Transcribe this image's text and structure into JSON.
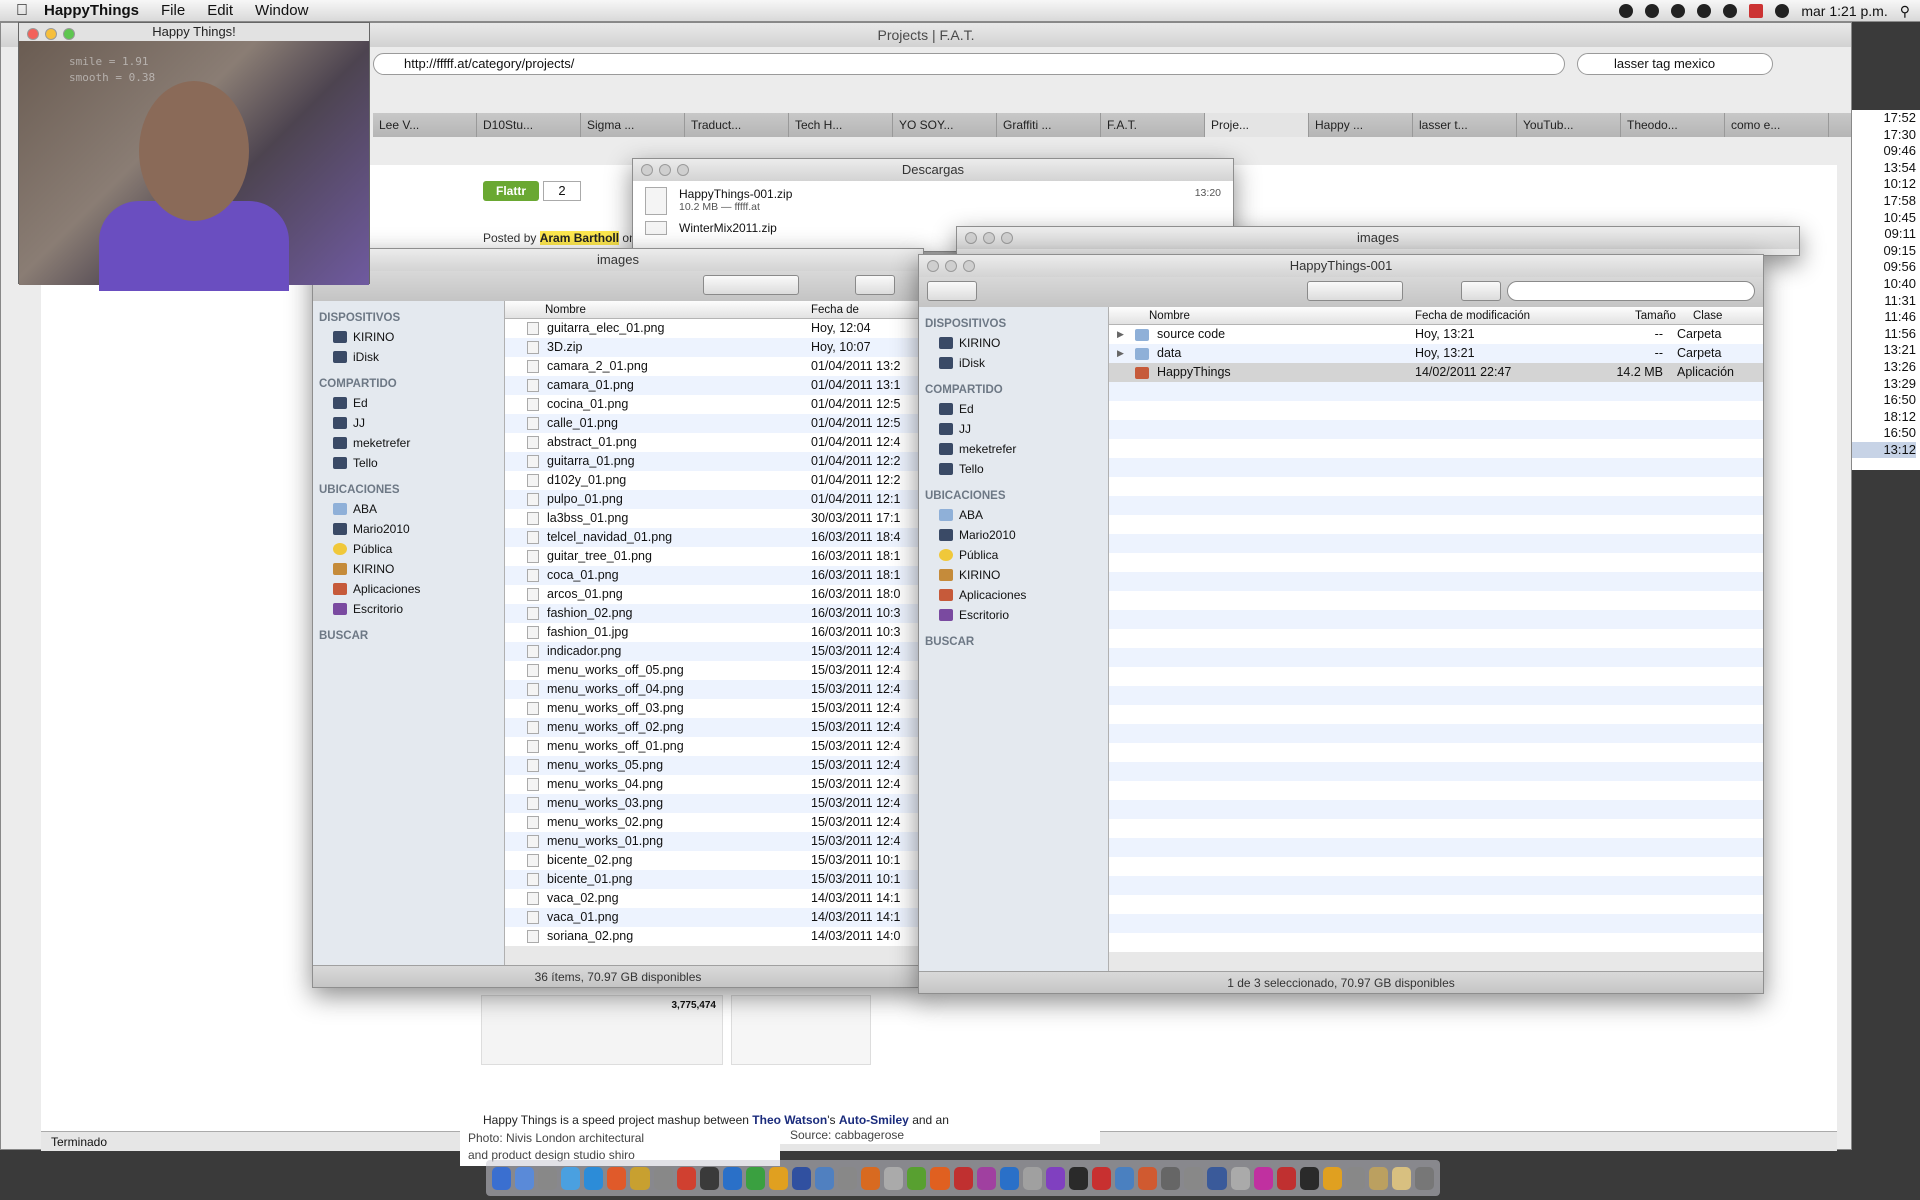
{
  "menubar": {
    "app_name": "HappyThings",
    "menus": [
      "File",
      "Edit",
      "Window"
    ],
    "clock": "mar 1:21 p.m."
  },
  "browser": {
    "title": "Projects | F.A.T.",
    "url": "http://fffff.at/category/projects/",
    "search_value": "lasser tag mexico",
    "tabs": [
      "Lee V...",
      "D10Stu...",
      "Sigma ...",
      "Traduct...",
      "Tech H...",
      "YO SOY...",
      "Graffiti ...",
      "F.A.T.",
      "Proje...",
      "Happy ...",
      "lasser t...",
      "YouTub...",
      "Theodo...",
      "como e..."
    ],
    "status": "Terminado",
    "flattr_label": "Flattr",
    "flattr_count": "2",
    "posted_prefix": "Posted by",
    "posted_author": "Aram Bartholl",
    "posted_suffix": "on",
    "body_prefix": "Happy Things is a speed project mashup between",
    "body_link1": "Theo Watson",
    "body_mid": "'s",
    "body_link2": "Auto-Smiley",
    "body_suffix": "and an",
    "photo_caption1": "Photo: Nivis London architectural",
    "photo_caption2": "and product design studio shiro",
    "source": "Source: cabbagerose",
    "views": "3,775,474"
  },
  "timestamps": [
    "17:52",
    "17:30",
    "09:46",
    "13:54",
    "10:12",
    "17:58",
    "10:45",
    "09:11",
    "09:15",
    "09:56",
    "10:40",
    "11:31",
    "11:46",
    "11:56",
    "13:21",
    "13:26",
    "13:29",
    "16:50",
    "18:12",
    "16:50",
    "13:12"
  ],
  "webcam": {
    "title": "Happy Things!",
    "overlay_smile": "smile      = 1.91",
    "overlay_smooth": "smooth = 0.38"
  },
  "downloads": {
    "title": "Descargas",
    "items": [
      {
        "name": "HappyThings-001.zip",
        "meta": "10.2 MB — fffff.at",
        "time": "13:20"
      },
      {
        "name": "WinterMix2011.zip",
        "meta": "",
        "time": ""
      }
    ]
  },
  "finder_images": {
    "title": "images",
    "back_title": "images",
    "columns": {
      "name": "Nombre",
      "date": "Fecha de modificación"
    },
    "sidebar": {
      "devices_header": "DISPOSITIVOS",
      "devices": [
        "KIRINO",
        "iDisk"
      ],
      "shared_header": "COMPARTIDO",
      "shared": [
        "Ed",
        "JJ",
        "meketrefer",
        "Tello"
      ],
      "places_header": "UBICACIONES",
      "places": [
        "ABA",
        "Mario2010",
        "Pública",
        "KIRINO",
        "Aplicaciones",
        "Escritorio"
      ],
      "search_header": "BUSCAR"
    },
    "files": [
      {
        "name": "guitarra_elec_01.png",
        "date": "Hoy, 12:04"
      },
      {
        "name": "3D.zip",
        "date": "Hoy, 10:07"
      },
      {
        "name": "camara_2_01.png",
        "date": "01/04/2011 13:2"
      },
      {
        "name": "camara_01.png",
        "date": "01/04/2011 13:1"
      },
      {
        "name": "cocina_01.png",
        "date": "01/04/2011 12:5"
      },
      {
        "name": "calle_01.png",
        "date": "01/04/2011 12:5"
      },
      {
        "name": "abstract_01.png",
        "date": "01/04/2011 12:4"
      },
      {
        "name": "guitarra_01.png",
        "date": "01/04/2011 12:2"
      },
      {
        "name": "d102y_01.png",
        "date": "01/04/2011 12:2"
      },
      {
        "name": "pulpo_01.png",
        "date": "01/04/2011 12:1"
      },
      {
        "name": "la3bss_01.png",
        "date": "30/03/2011 17:1"
      },
      {
        "name": "telcel_navidad_01.png",
        "date": "16/03/2011 18:4"
      },
      {
        "name": "guitar_tree_01.png",
        "date": "16/03/2011 18:1"
      },
      {
        "name": "coca_01.png",
        "date": "16/03/2011 18:1"
      },
      {
        "name": "arcos_01.png",
        "date": "16/03/2011 18:0"
      },
      {
        "name": "fashion_02.png",
        "date": "16/03/2011 10:3"
      },
      {
        "name": "fashion_01.jpg",
        "date": "16/03/2011 10:3"
      },
      {
        "name": "indicador.png",
        "date": "15/03/2011 12:4"
      },
      {
        "name": "menu_works_off_05.png",
        "date": "15/03/2011 12:4"
      },
      {
        "name": "menu_works_off_04.png",
        "date": "15/03/2011 12:4"
      },
      {
        "name": "menu_works_off_03.png",
        "date": "15/03/2011 12:4"
      },
      {
        "name": "menu_works_off_02.png",
        "date": "15/03/2011 12:4"
      },
      {
        "name": "menu_works_off_01.png",
        "date": "15/03/2011 12:4"
      },
      {
        "name": "menu_works_05.png",
        "date": "15/03/2011 12:4"
      },
      {
        "name": "menu_works_04.png",
        "date": "15/03/2011 12:4"
      },
      {
        "name": "menu_works_03.png",
        "date": "15/03/2011 12:4"
      },
      {
        "name": "menu_works_02.png",
        "date": "15/03/2011 12:4"
      },
      {
        "name": "menu_works_01.png",
        "date": "15/03/2011 12:4"
      },
      {
        "name": "bicente_02.png",
        "date": "15/03/2011 10:1"
      },
      {
        "name": "bicente_01.png",
        "date": "15/03/2011 10:1"
      },
      {
        "name": "vaca_02.png",
        "date": "14/03/2011 14:1"
      },
      {
        "name": "vaca_01.png",
        "date": "14/03/2011 14:1"
      },
      {
        "name": "soriana_02.png",
        "date": "14/03/2011 14:0"
      }
    ],
    "status": "36 ítems, 70.97 GB disponibles"
  },
  "finder_happy": {
    "title": "HappyThings-001",
    "columns": {
      "name": "Nombre",
      "date": "Fecha de modificación",
      "size": "Tamaño",
      "kind": "Clase"
    },
    "sidebar": {
      "devices_header": "DISPOSITIVOS",
      "devices": [
        "KIRINO",
        "iDisk"
      ],
      "shared_header": "COMPARTIDO",
      "shared": [
        "Ed",
        "JJ",
        "meketrefer",
        "Tello"
      ],
      "places_header": "UBICACIONES",
      "places": [
        "ABA",
        "Mario2010",
        "Pública",
        "KIRINO",
        "Aplicaciones",
        "Escritorio"
      ],
      "search_header": "BUSCAR"
    },
    "files": [
      {
        "name": "source code",
        "date": "Hoy, 13:21",
        "size": "--",
        "kind": "Carpeta"
      },
      {
        "name": "data",
        "date": "Hoy, 13:21",
        "size": "--",
        "kind": "Carpeta"
      },
      {
        "name": "HappyThings",
        "date": "14/02/2011 22:47",
        "size": "14.2 MB",
        "kind": "Aplicación"
      }
    ],
    "status": "1 de 3 seleccionado, 70.97 GB disponibles"
  }
}
